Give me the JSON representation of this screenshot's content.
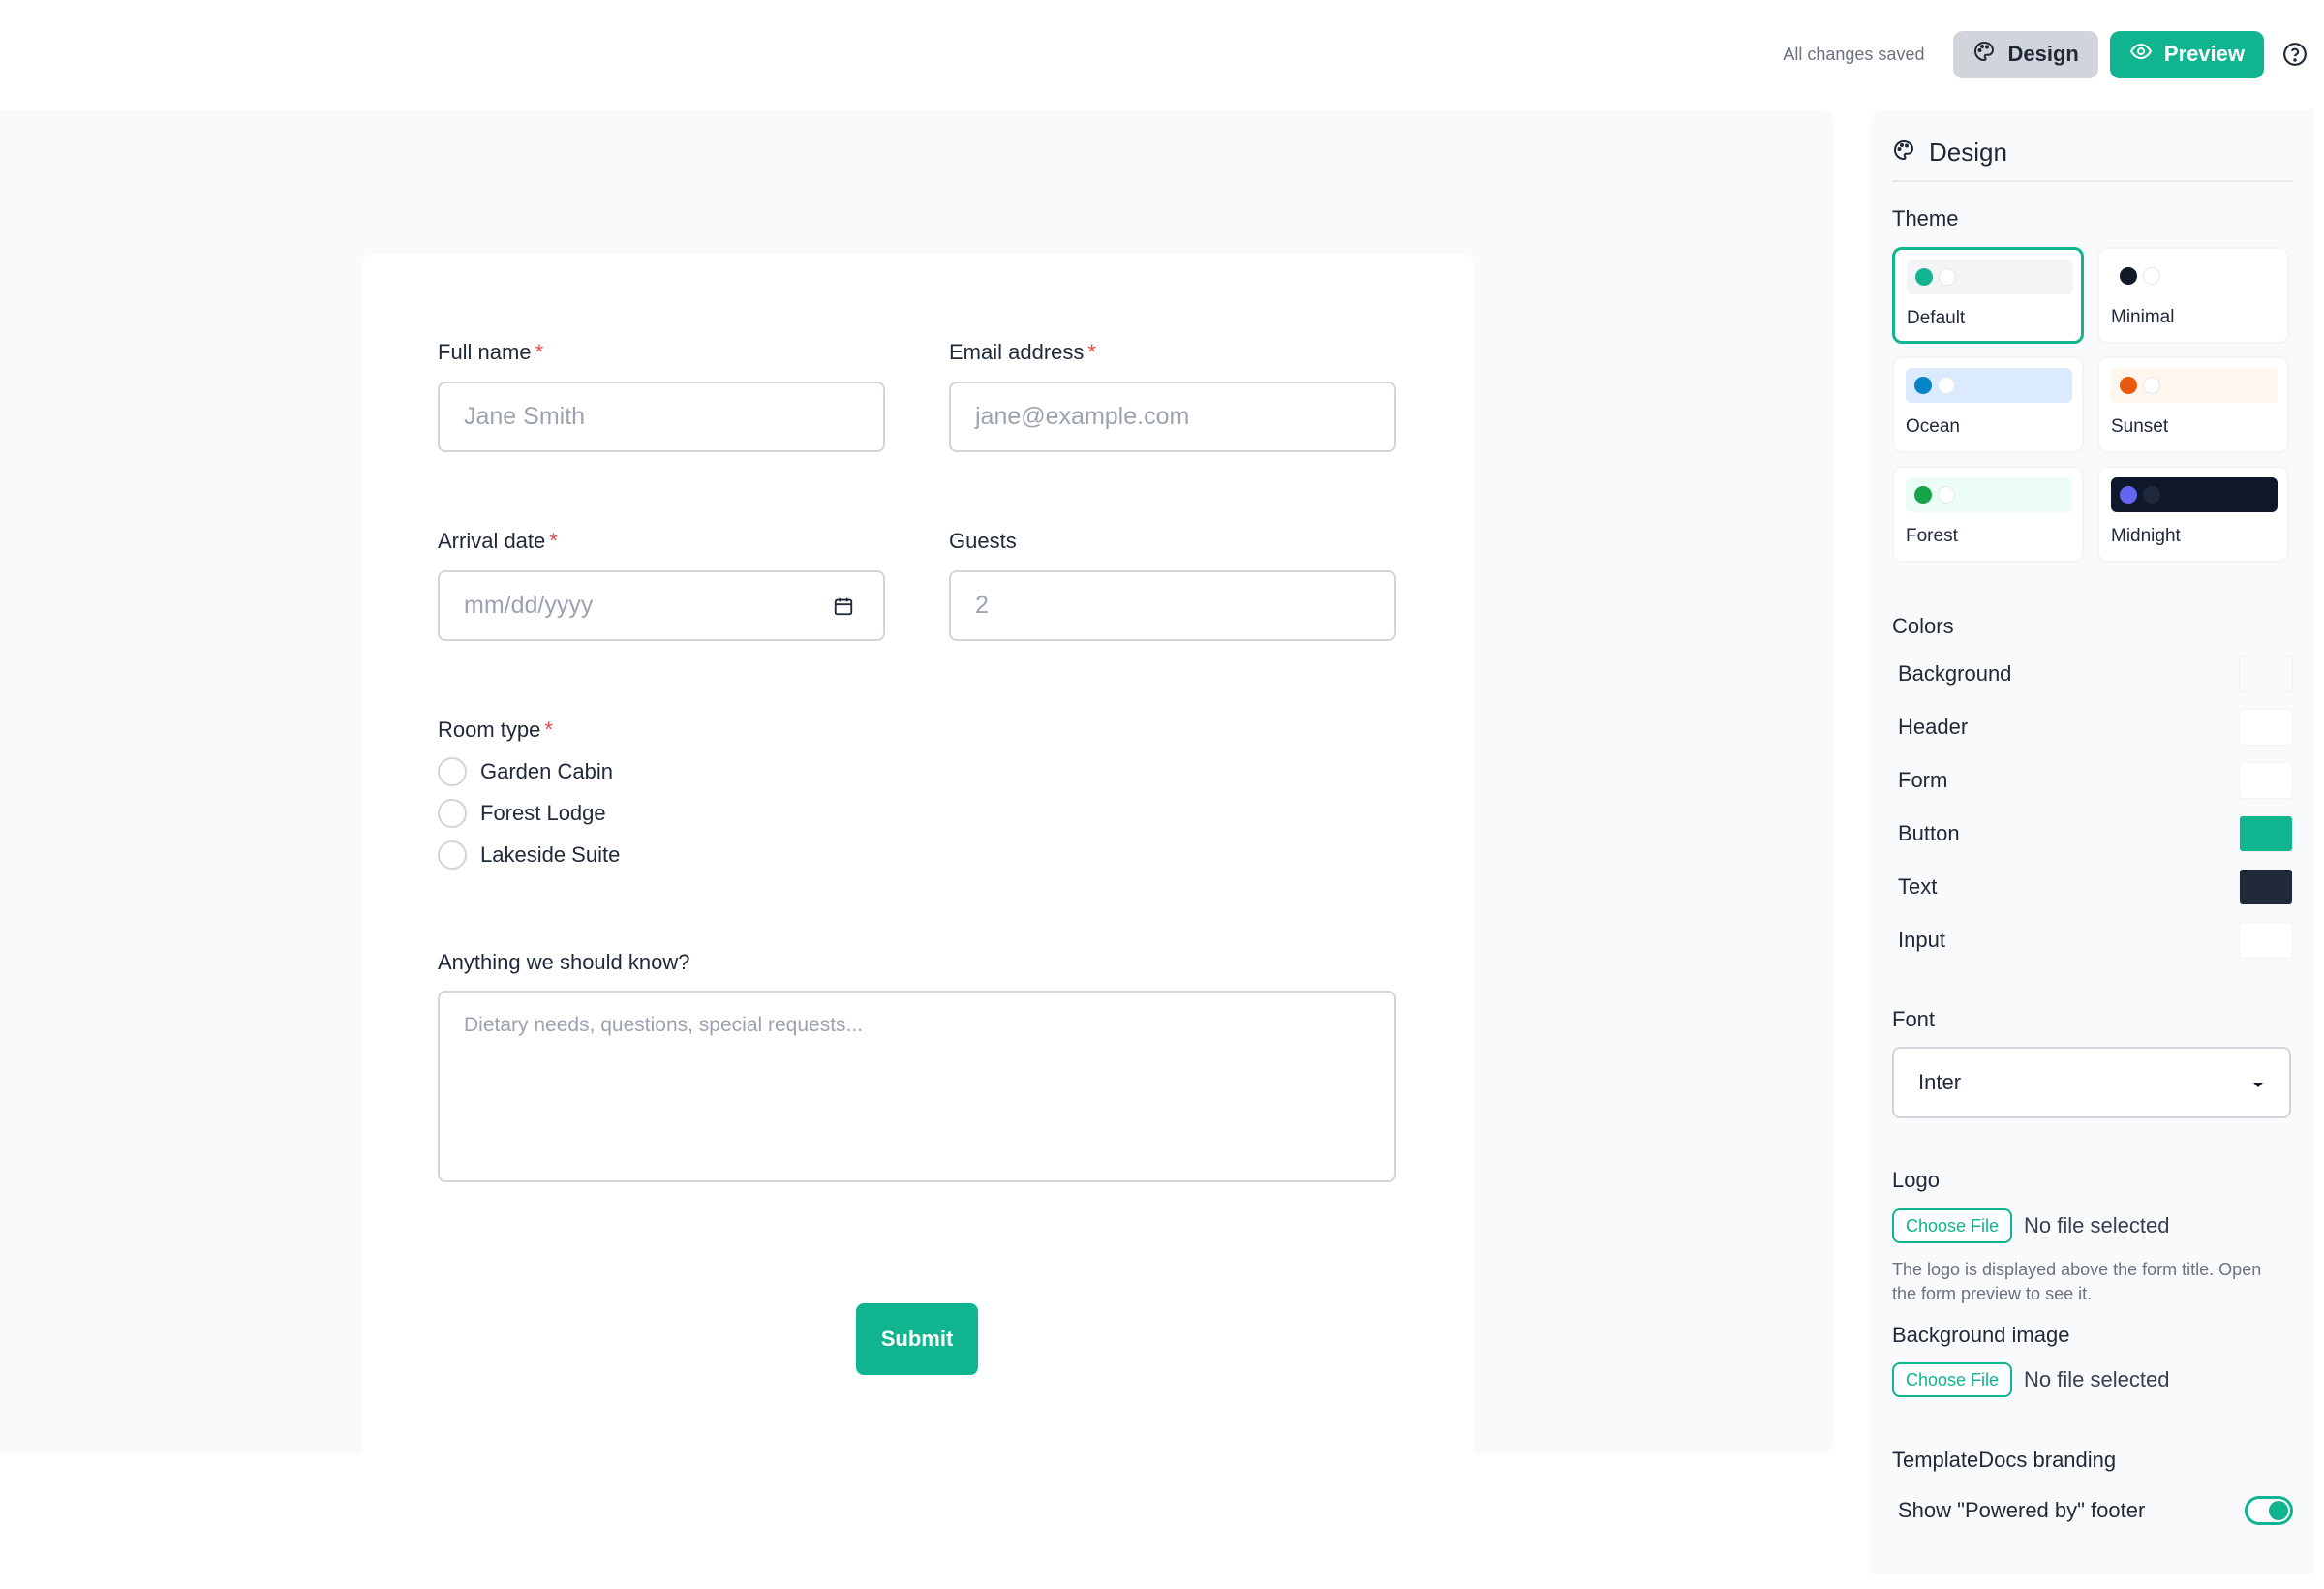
{
  "topbar": {
    "save_status": "All changes saved",
    "design_label": "Design",
    "preview_label": "Preview"
  },
  "form": {
    "full_name_label": "Full name",
    "full_name_placeholder": "Jane Smith",
    "email_label": "Email address",
    "email_placeholder": "jane@example.com",
    "arrival_label": "Arrival date",
    "arrival_placeholder": "mm/dd/yyyy",
    "guests_label": "Guests",
    "guests_value": "2",
    "required_mark": "*",
    "room_label": "Room type",
    "room_options": [
      "Garden Cabin",
      "Forest Lodge",
      "Lakeside Suite"
    ],
    "notes_label": "Anything we should know?",
    "notes_placeholder": "Dietary needs, questions, special requests...",
    "submit_label": "Submit"
  },
  "panel": {
    "title": "Design",
    "theme_label": "Theme",
    "themes": [
      {
        "name": "Default",
        "dot": "#10b48f",
        "swatch_bg": "#f3f4f6",
        "selected": true
      },
      {
        "name": "Minimal",
        "dot": "#111827",
        "swatch_bg": "#ffffff",
        "selected": false
      },
      {
        "name": "Ocean",
        "dot": "#0284c7",
        "swatch_bg": "#dbeafe",
        "selected": false
      },
      {
        "name": "Sunset",
        "dot": "#ea580c",
        "swatch_bg": "#fff7ed",
        "selected": false
      },
      {
        "name": "Forest",
        "dot": "#16a34a",
        "swatch_bg": "#ecfdf5",
        "selected": false
      },
      {
        "name": "Midnight",
        "dot": "#6366f1",
        "swatch_bg": "#0f172a",
        "selected": false
      }
    ],
    "colors_label": "Colors",
    "colors": [
      {
        "label": "Background",
        "value": "#f9fafb"
      },
      {
        "label": "Header",
        "value": "#ffffff"
      },
      {
        "label": "Form",
        "value": "#ffffff"
      },
      {
        "label": "Button",
        "value": "#10b48f"
      },
      {
        "label": "Text",
        "value": "#1f2937"
      },
      {
        "label": "Input",
        "value": "#ffffff"
      }
    ],
    "font_label": "Font",
    "font_value": "Inter",
    "logo_label": "Logo",
    "choose_file": "Choose File",
    "no_file": "No file selected",
    "logo_hint": "The logo is displayed above the form title. Open the form preview to see it.",
    "bg_image_label": "Background image",
    "branding_label": "TemplateDocs branding",
    "powered_by_label": "Show \"Powered by\" footer"
  }
}
